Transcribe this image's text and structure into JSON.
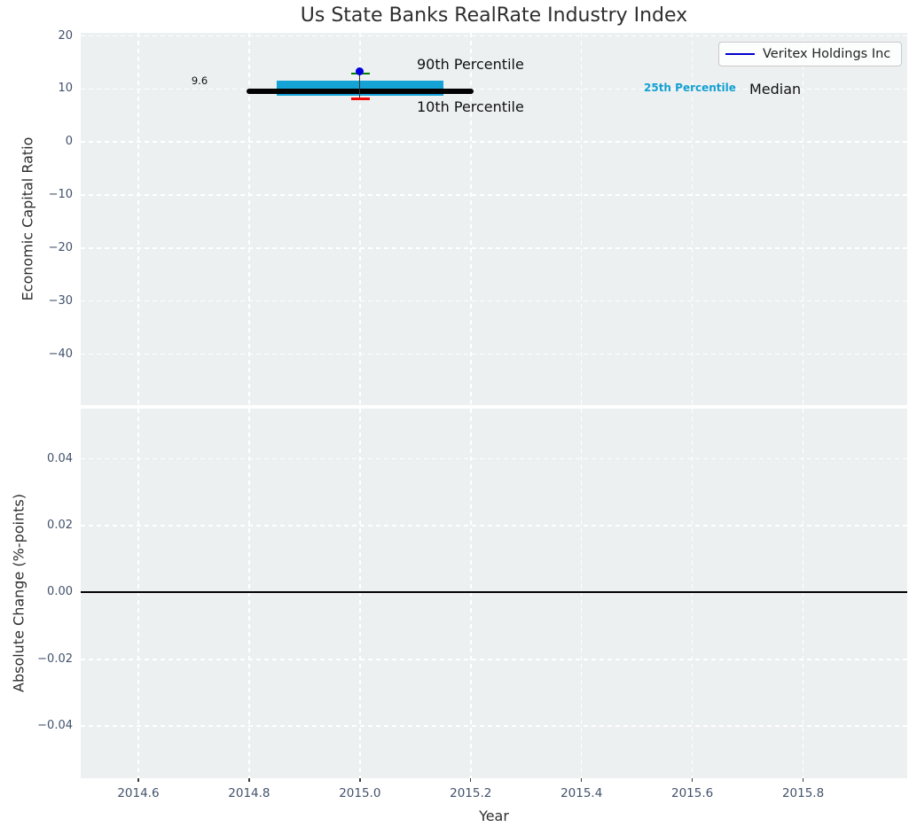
{
  "title": "Us State Banks RealRate Industry Index",
  "legend": {
    "label": "Veritex Holdings Inc"
  },
  "annotations": {
    "median_value_label": "9.6",
    "p90_label": "90th Percentile",
    "p10_label": "10th Percentile",
    "p25_label": "25th Percentile",
    "median_label": "Median"
  },
  "chart_data": {
    "type": "boxplot",
    "title": "Us State Banks RealRate Industry Index",
    "xlabel": "Year",
    "xlim": [
      2014.496,
      2015.988
    ],
    "x_ticks": {
      "labels": [
        "2014.6",
        "2014.8",
        "2015.0",
        "2015.2",
        "2015.4",
        "2015.6",
        "2015.8"
      ],
      "values": [
        2014.6,
        2014.8,
        2015.0,
        2015.2,
        2015.4,
        2015.6,
        2015.8
      ]
    },
    "grid": true,
    "legend_position": "upper right",
    "subplots": [
      {
        "name": "economic-capital-ratio",
        "ylabel": "Economic Capital Ratio",
        "ylim": [
          -49.6,
          20.6
        ],
        "y_ticks": {
          "labels": [
            "20",
            "10",
            "0",
            "−10",
            "−20",
            "−30",
            "−40"
          ],
          "values": [
            20,
            10,
            0,
            -10,
            -20,
            -30,
            -40
          ]
        },
        "box": {
          "year": 2015.0,
          "median": 9.6,
          "p25": 8.7,
          "p75": 11.5,
          "p10": 8.1,
          "p90": 12.9,
          "median_xspan": [
            2014.8,
            2015.2
          ],
          "box_xspan": [
            2014.85,
            2015.15
          ],
          "cap_xspan": [
            2014.984,
            2015.018
          ]
        },
        "company_point": {
          "name": "Veritex Holdings Inc",
          "year": 2015.0,
          "value": 13.3
        }
      },
      {
        "name": "absolute-change",
        "ylabel": "Absolute Change (%-points)",
        "ylim": [
          -0.0556,
          0.055
        ],
        "y_ticks": {
          "labels": [
            "0.04",
            "0.02",
            "0.00",
            "−0.02",
            "−0.04"
          ],
          "values": [
            0.04,
            0.02,
            0.0,
            -0.02,
            -0.04
          ]
        },
        "zero_line": 0.0
      }
    ],
    "colors": {
      "box_fill": "#15a3d6",
      "median_line": "#000000",
      "p90_cap": "#008000",
      "p10_cap": "#f00505",
      "company_marker": "#0000e0",
      "legend_line": "#0000cc",
      "plot_bg": "#ecf0f1",
      "grid": "#ffffff",
      "tick_label": "#42526b",
      "zero_line": "#000000"
    }
  }
}
